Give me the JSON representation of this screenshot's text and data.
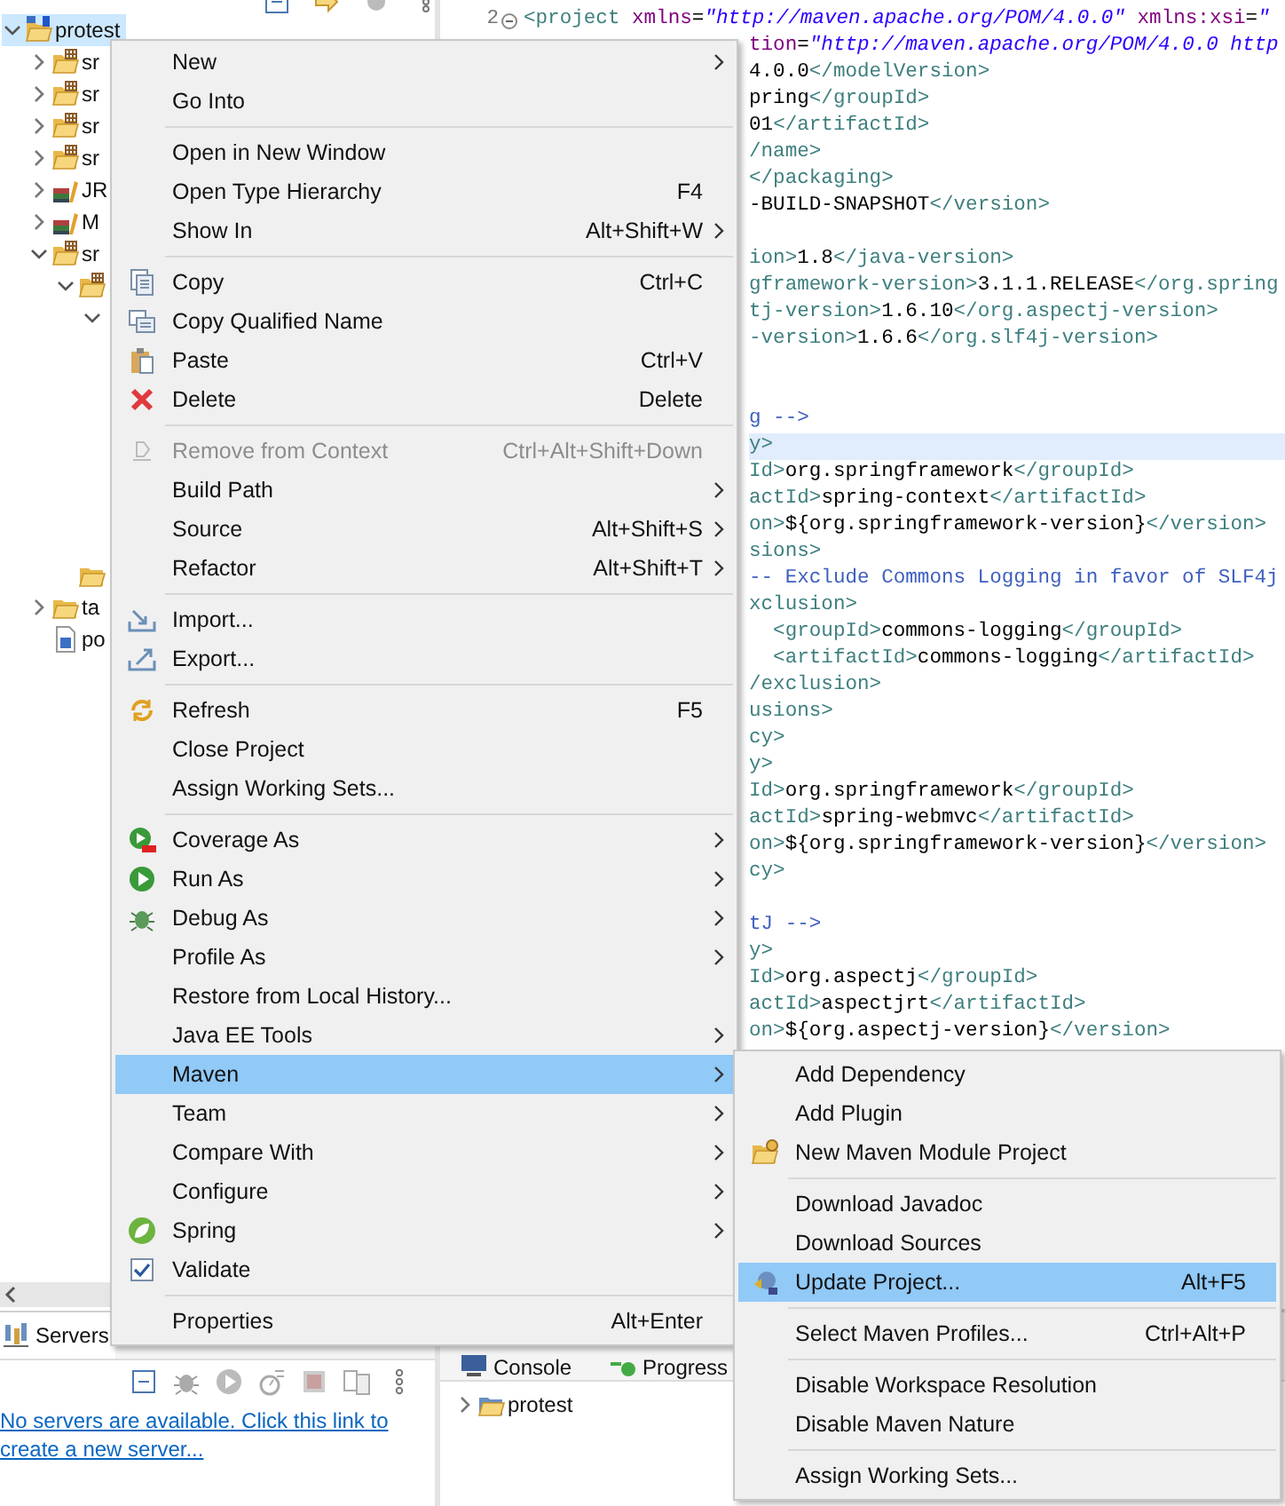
{
  "package_explorer": {
    "tree": [
      {
        "label": "protest",
        "kind": "project",
        "expanded": true,
        "selected": true,
        "children": [
          {
            "label": "sr",
            "kind": "source-folder",
            "expanded": false,
            "selected": false
          },
          {
            "label": "sr",
            "kind": "source-folder",
            "expanded": false,
            "selected": false
          },
          {
            "label": "sr",
            "kind": "source-folder",
            "expanded": false,
            "selected": false
          },
          {
            "label": "sr",
            "kind": "source-folder",
            "expanded": false,
            "selected": false
          },
          {
            "label": "JR",
            "kind": "library",
            "expanded": false,
            "selected": false
          },
          {
            "label": "M",
            "kind": "library",
            "expanded": false,
            "selected": false
          },
          {
            "label": "sr",
            "kind": "source-folder",
            "expanded": true,
            "selected": false,
            "children": [
              {
                "kind": "source-folder",
                "expanded": true,
                "selected": false,
                "children": [
                  {
                    "expanded": true,
                    "selected": false
                  }
                ]
              },
              {
                "kind": "folder",
                "selected": false
              }
            ]
          },
          {
            "label": "ta",
            "kind": "folder",
            "expanded": false,
            "selected": false
          },
          {
            "label": "po",
            "kind": "pom-file",
            "selected": false
          }
        ]
      }
    ]
  },
  "editor": {
    "lines": [
      {
        "number": "2",
        "current": false,
        "segments": [
          {
            "kind": "tag",
            "text": "<project"
          },
          {
            "kind": "attr",
            "text": " xmlns"
          },
          {
            "kind": "text",
            "text": "="
          },
          {
            "kind": "string",
            "text": "\"http://maven.apache.org/POM/4.0.0\""
          },
          {
            "kind": "attr",
            "text": " xmlns:xsi"
          },
          {
            "kind": "text",
            "text": "="
          },
          {
            "kind": "string",
            "text": "\""
          }
        ]
      },
      {
        "current": false,
        "segments": [
          {
            "kind": "attr",
            "text": "tion"
          },
          {
            "kind": "text",
            "text": "="
          },
          {
            "kind": "string",
            "text": "\"http://maven.apache.org/POM/4.0.0 http"
          }
        ]
      },
      {
        "current": false,
        "segments": [
          {
            "kind": "text",
            "text": "4.0.0"
          },
          {
            "kind": "tag",
            "text": "</modelVersion>"
          }
        ]
      },
      {
        "current": false,
        "segments": [
          {
            "kind": "text",
            "text": "pring"
          },
          {
            "kind": "tag",
            "text": "</groupId>"
          }
        ]
      },
      {
        "current": false,
        "segments": [
          {
            "kind": "text",
            "text": "01"
          },
          {
            "kind": "tag",
            "text": "</artifactId>"
          }
        ]
      },
      {
        "current": false,
        "segments": [
          {
            "kind": "tag",
            "text": "/name>"
          }
        ]
      },
      {
        "current": false,
        "segments": [
          {
            "kind": "tag",
            "text": "</packaging>"
          }
        ]
      },
      {
        "current": false,
        "segments": [
          {
            "kind": "text",
            "text": "-BUILD-SNAPSHOT"
          },
          {
            "kind": "tag",
            "text": "</version>"
          }
        ]
      },
      {
        "current": false
      },
      {
        "current": false,
        "segments": [
          {
            "kind": "tag",
            "text": "ion>"
          },
          {
            "kind": "text",
            "text": "1.8"
          },
          {
            "kind": "tag",
            "text": "</java-version>"
          }
        ]
      },
      {
        "current": false,
        "segments": [
          {
            "kind": "tag",
            "text": "gframework-version>"
          },
          {
            "kind": "text",
            "text": "3.1.1.RELEASE"
          },
          {
            "kind": "tag",
            "text": "</org.spring"
          }
        ]
      },
      {
        "current": false,
        "segments": [
          {
            "kind": "tag",
            "text": "tj-version>"
          },
          {
            "kind": "text",
            "text": "1.6.10"
          },
          {
            "kind": "tag",
            "text": "</org.aspectj-version>"
          }
        ]
      },
      {
        "current": false,
        "segments": [
          {
            "kind": "tag",
            "text": "-version>"
          },
          {
            "kind": "text",
            "text": "1.6.6"
          },
          {
            "kind": "tag",
            "text": "</org.slf4j-version>"
          }
        ]
      },
      {
        "current": false
      },
      {
        "current": false
      },
      {
        "current": false,
        "segments": [
          {
            "kind": "comment",
            "text": "g -->"
          }
        ]
      },
      {
        "current": true,
        "segments": [
          {
            "kind": "tag",
            "text": "y>"
          }
        ]
      },
      {
        "current": false,
        "segments": [
          {
            "kind": "tag",
            "text": "Id>"
          },
          {
            "kind": "text",
            "text": "org.springframework"
          },
          {
            "kind": "tag",
            "text": "</groupId>"
          }
        ]
      },
      {
        "current": false,
        "segments": [
          {
            "kind": "tag",
            "text": "actId>"
          },
          {
            "kind": "text",
            "text": "spring-context"
          },
          {
            "kind": "tag",
            "text": "</artifactId>"
          }
        ]
      },
      {
        "current": false,
        "segments": [
          {
            "kind": "tag",
            "text": "on>"
          },
          {
            "kind": "text",
            "text": "${org.springframework-version}"
          },
          {
            "kind": "tag",
            "text": "</version>"
          }
        ]
      },
      {
        "current": false,
        "segments": [
          {
            "kind": "tag",
            "text": "sions>"
          }
        ]
      },
      {
        "current": false,
        "segments": [
          {
            "kind": "comment",
            "text": "-- Exclude Commons Logging in favor of SLF4j"
          }
        ]
      },
      {
        "current": false,
        "segments": [
          {
            "kind": "tag",
            "text": "xclusion>"
          }
        ]
      },
      {
        "current": false,
        "segments": [
          {
            "kind": "tag",
            "text": "  <groupId>"
          },
          {
            "kind": "text",
            "text": "commons-logging"
          },
          {
            "kind": "tag",
            "text": "</groupId>"
          }
        ]
      },
      {
        "current": false,
        "segments": [
          {
            "kind": "tag",
            "text": "  <artifactId>"
          },
          {
            "kind": "text",
            "text": "commons-logging"
          },
          {
            "kind": "tag",
            "text": "</artifactId>"
          }
        ]
      },
      {
        "current": false,
        "segments": [
          {
            "kind": "tag",
            "text": "/exclusion>"
          }
        ]
      },
      {
        "current": false,
        "segments": [
          {
            "kind": "tag",
            "text": "usions>"
          }
        ]
      },
      {
        "current": false,
        "segments": [
          {
            "kind": "tag",
            "text": "cy>"
          }
        ]
      },
      {
        "current": false,
        "segments": [
          {
            "kind": "tag",
            "text": "y>"
          }
        ]
      },
      {
        "current": false,
        "segments": [
          {
            "kind": "tag",
            "text": "Id>"
          },
          {
            "kind": "text",
            "text": "org.springframework"
          },
          {
            "kind": "tag",
            "text": "</groupId>"
          }
        ]
      },
      {
        "current": false,
        "segments": [
          {
            "kind": "tag",
            "text": "actId>"
          },
          {
            "kind": "text",
            "text": "spring-webmvc"
          },
          {
            "kind": "tag",
            "text": "</artifactId>"
          }
        ]
      },
      {
        "current": false,
        "segments": [
          {
            "kind": "tag",
            "text": "on>"
          },
          {
            "kind": "text",
            "text": "${org.springframework-version}"
          },
          {
            "kind": "tag",
            "text": "</version>"
          }
        ]
      },
      {
        "current": false,
        "segments": [
          {
            "kind": "tag",
            "text": "cy>"
          }
        ]
      },
      {
        "current": false
      },
      {
        "current": false,
        "segments": [
          {
            "kind": "comment",
            "text": "tJ -->"
          }
        ]
      },
      {
        "current": false,
        "segments": [
          {
            "kind": "tag",
            "text": "y>"
          }
        ]
      },
      {
        "current": false,
        "segments": [
          {
            "kind": "tag",
            "text": "Id>"
          },
          {
            "kind": "text",
            "text": "org.aspectj"
          },
          {
            "kind": "tag",
            "text": "</groupId>"
          }
        ]
      },
      {
        "current": false,
        "segments": [
          {
            "kind": "tag",
            "text": "actId>"
          },
          {
            "kind": "text",
            "text": "aspectjrt"
          },
          {
            "kind": "tag",
            "text": "</artifactId>"
          }
        ]
      },
      {
        "current": false,
        "segments": [
          {
            "kind": "tag",
            "text": "on>"
          },
          {
            "kind": "text",
            "text": "${org.aspectj-version}"
          },
          {
            "kind": "tag",
            "text": "</version>"
          }
        ]
      }
    ]
  },
  "servers_panel": {
    "tab": "Servers",
    "message": "No servers are available. Click this link to create a new server..."
  },
  "console_panel": {
    "tabs": [
      {
        "label": "Console"
      },
      {
        "label": "Progress"
      }
    ],
    "tree": [
      {
        "label": "protest",
        "expanded": false
      }
    ]
  },
  "context_menu": {
    "items": [
      {
        "kind": "item",
        "label": "New",
        "submenu": true,
        "disabled": false,
        "selected": false
      },
      {
        "kind": "item",
        "label": "Go Into",
        "submenu": false,
        "disabled": false,
        "selected": false
      },
      {
        "kind": "separator"
      },
      {
        "kind": "item",
        "label": "Open in New Window",
        "submenu": false,
        "disabled": false,
        "selected": false
      },
      {
        "kind": "item",
        "label": "Open Type Hierarchy",
        "shortcut": "F4",
        "submenu": false,
        "disabled": false,
        "selected": false
      },
      {
        "kind": "item",
        "label": "Show In",
        "shortcut": "Alt+Shift+W",
        "submenu": true,
        "disabled": false,
        "selected": false
      },
      {
        "kind": "separator"
      },
      {
        "kind": "item",
        "label": "Copy",
        "shortcut": "Ctrl+C",
        "submenu": false,
        "disabled": false,
        "selected": false
      },
      {
        "kind": "item",
        "label": "Copy Qualified Name",
        "submenu": false,
        "disabled": false,
        "selected": false
      },
      {
        "kind": "item",
        "label": "Paste",
        "shortcut": "Ctrl+V",
        "submenu": false,
        "disabled": false,
        "selected": false
      },
      {
        "kind": "item",
        "label": "Delete",
        "shortcut": "Delete",
        "submenu": false,
        "disabled": false,
        "selected": false
      },
      {
        "kind": "separator"
      },
      {
        "kind": "item",
        "label": "Remove from Context",
        "shortcut": "Ctrl+Alt+Shift+Down",
        "submenu": false,
        "disabled": true,
        "selected": false
      },
      {
        "kind": "item",
        "label": "Build Path",
        "submenu": true,
        "disabled": false,
        "selected": false
      },
      {
        "kind": "item",
        "label": "Source",
        "shortcut": "Alt+Shift+S",
        "submenu": true,
        "disabled": false,
        "selected": false
      },
      {
        "kind": "item",
        "label": "Refactor",
        "shortcut": "Alt+Shift+T",
        "submenu": true,
        "disabled": false,
        "selected": false
      },
      {
        "kind": "separator"
      },
      {
        "kind": "item",
        "label": "Import...",
        "submenu": false,
        "disabled": false,
        "selected": false
      },
      {
        "kind": "item",
        "label": "Export...",
        "submenu": false,
        "disabled": false,
        "selected": false
      },
      {
        "kind": "separator"
      },
      {
        "kind": "item",
        "label": "Refresh",
        "shortcut": "F5",
        "submenu": false,
        "disabled": false,
        "selected": false
      },
      {
        "kind": "item",
        "label": "Close Project",
        "submenu": false,
        "disabled": false,
        "selected": false
      },
      {
        "kind": "item",
        "label": "Assign Working Sets...",
        "submenu": false,
        "disabled": false,
        "selected": false
      },
      {
        "kind": "separator"
      },
      {
        "kind": "item",
        "label": "Coverage As",
        "submenu": true,
        "disabled": false,
        "selected": false
      },
      {
        "kind": "item",
        "label": "Run As",
        "submenu": true,
        "disabled": false,
        "selected": false
      },
      {
        "kind": "item",
        "label": "Debug As",
        "submenu": true,
        "disabled": false,
        "selected": false
      },
      {
        "kind": "item",
        "label": "Profile As",
        "submenu": true,
        "disabled": false,
        "selected": false
      },
      {
        "kind": "item",
        "label": "Restore from Local History...",
        "submenu": false,
        "disabled": false,
        "selected": false
      },
      {
        "kind": "item",
        "label": "Java EE Tools",
        "submenu": true,
        "disabled": false,
        "selected": false
      },
      {
        "kind": "item",
        "label": "Maven",
        "submenu": true,
        "disabled": false,
        "selected": true
      },
      {
        "kind": "item",
        "label": "Team",
        "submenu": true,
        "disabled": false,
        "selected": false
      },
      {
        "kind": "item",
        "label": "Compare With",
        "submenu": true,
        "disabled": false,
        "selected": false
      },
      {
        "kind": "item",
        "label": "Configure",
        "submenu": true,
        "disabled": false,
        "selected": false
      },
      {
        "kind": "item",
        "label": "Spring",
        "submenu": true,
        "disabled": false,
        "selected": false
      },
      {
        "kind": "item",
        "label": "Validate",
        "submenu": false,
        "disabled": false,
        "selected": false
      },
      {
        "kind": "separator"
      },
      {
        "kind": "item",
        "label": "Properties",
        "shortcut": "Alt+Enter",
        "submenu": false,
        "disabled": false,
        "selected": false
      }
    ]
  },
  "maven_submenu": {
    "items": [
      {
        "kind": "item",
        "label": "Add Dependency",
        "selected": false
      },
      {
        "kind": "item",
        "label": "Add Plugin",
        "selected": false
      },
      {
        "kind": "item",
        "label": "New Maven Module Project",
        "selected": false
      },
      {
        "kind": "separator"
      },
      {
        "kind": "item",
        "label": "Download Javadoc",
        "selected": false
      },
      {
        "kind": "item",
        "label": "Download Sources",
        "selected": false
      },
      {
        "kind": "item",
        "label": "Update Project...",
        "shortcut": "Alt+F5",
        "selected": true
      },
      {
        "kind": "separator"
      },
      {
        "kind": "item",
        "label": "Select Maven Profiles...",
        "shortcut": "Ctrl+Alt+P",
        "selected": false
      },
      {
        "kind": "separator"
      },
      {
        "kind": "item",
        "label": "Disable Workspace Resolution",
        "selected": false
      },
      {
        "kind": "item",
        "label": "Disable Maven Nature",
        "selected": false
      },
      {
        "kind": "separator"
      },
      {
        "kind": "item",
        "label": "Assign Working Sets...",
        "selected": false
      }
    ]
  }
}
